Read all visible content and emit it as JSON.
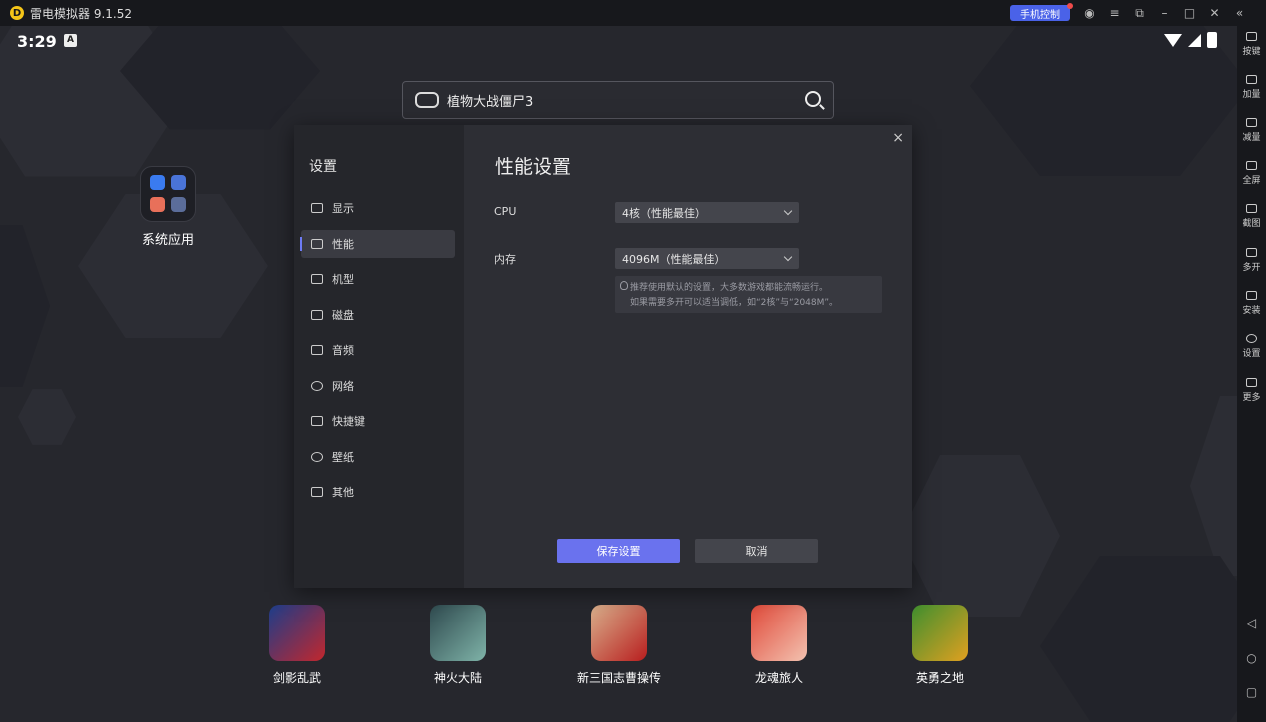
{
  "titlebar": {
    "title": "雷电模拟器 9.1.52",
    "logo_letter": "D",
    "phone_control": "手机控制",
    "icons": [
      "user-icon",
      "menu-icon",
      "restore-icon",
      "minimize-icon",
      "maximize-icon",
      "close-icon",
      "collapse-icon"
    ]
  },
  "status": {
    "time": "3:29",
    "a_badge": "A"
  },
  "search": {
    "text": "植物大战僵尸3"
  },
  "folder": {
    "label": "系统应用"
  },
  "dialog": {
    "side_title": "设置",
    "nav": [
      {
        "label": "显示"
      },
      {
        "label": "性能"
      },
      {
        "label": "机型"
      },
      {
        "label": "磁盘"
      },
      {
        "label": "音频"
      },
      {
        "label": "网络"
      },
      {
        "label": "快捷键"
      },
      {
        "label": "壁纸"
      },
      {
        "label": "其他"
      }
    ],
    "active_index": 1,
    "title": "性能设置",
    "cpu_label": "CPU",
    "cpu_value": "4核（性能最佳）",
    "mem_label": "内存",
    "mem_value": "4096M（性能最佳）",
    "hint_line1": "推荐使用默认的设置，大多数游戏都能流畅运行。",
    "hint_line2": "如果需要多开可以适当调低，如“2核”与“2048M”。",
    "save": "保存设置",
    "cancel": "取消",
    "close": "×"
  },
  "dock": [
    {
      "label": "剑影乱武",
      "color": "#1c3d8a"
    },
    {
      "label": "神火大陆",
      "color": "#2f4a4f"
    },
    {
      "label": "新三国志曹操传",
      "color": "#b81e1e"
    },
    {
      "label": "龙魂旅人",
      "color": "#e04a3a"
    },
    {
      "label": "英勇之地",
      "color": "#3f8f2f"
    }
  ],
  "sidebar": [
    {
      "label": "按键"
    },
    {
      "label": "加量"
    },
    {
      "label": "减量"
    },
    {
      "label": "全屏"
    },
    {
      "label": "截图"
    },
    {
      "label": "多开"
    },
    {
      "label": "安装"
    },
    {
      "label": "设置"
    },
    {
      "label": "更多"
    }
  ],
  "android_nav": [
    "back-icon",
    "home-icon",
    "recents-icon"
  ]
}
